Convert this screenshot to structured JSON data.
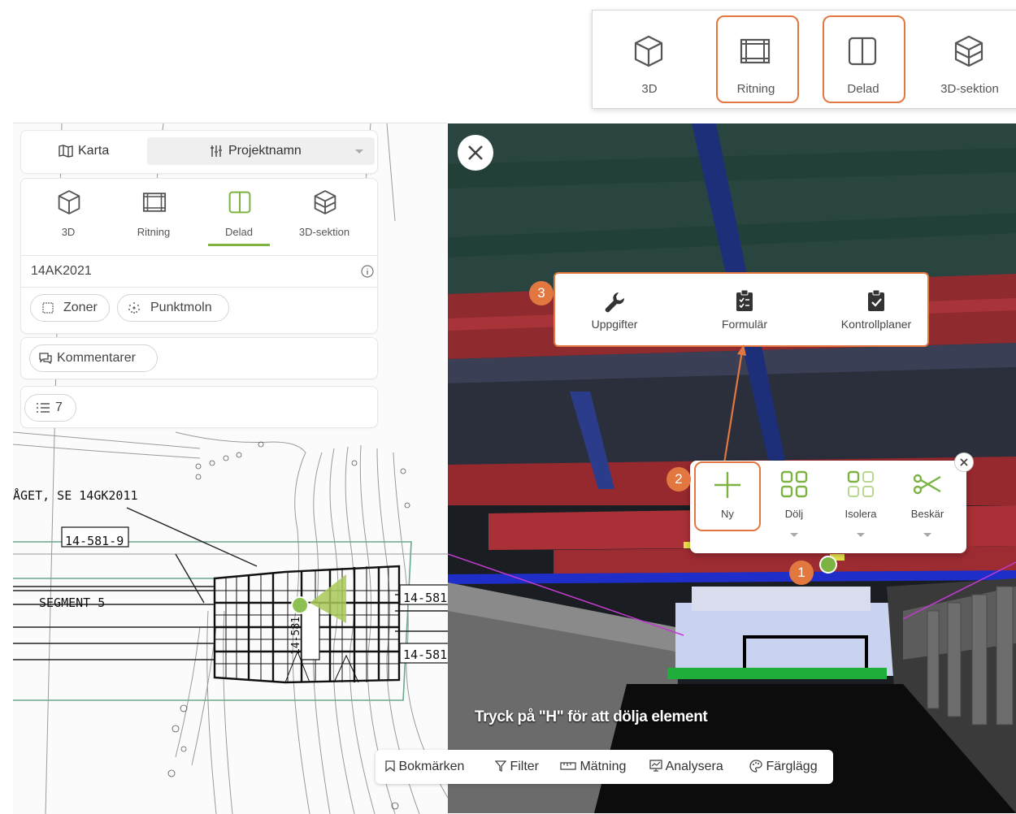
{
  "colors": {
    "accent_orange": "#e2773f",
    "active_green": "#7cb342",
    "badge_orange": "#e2773f"
  },
  "top_toolbar": {
    "items": [
      {
        "label": "3D",
        "icon": "cube-icon"
      },
      {
        "label": "Ritning",
        "icon": "drawing-icon"
      },
      {
        "label": "Delad",
        "icon": "split-view-icon"
      },
      {
        "label": "3D-sektion",
        "icon": "cube-section-icon"
      }
    ]
  },
  "left_panel": {
    "tabs": [
      {
        "label": "Karta",
        "icon": "map-icon"
      },
      {
        "label": "Projektnamn",
        "icon": "project-icon"
      }
    ],
    "modes": [
      {
        "label": "3D",
        "icon": "cube-icon"
      },
      {
        "label": "Ritning",
        "icon": "drawing-icon"
      },
      {
        "label": "Delad",
        "icon": "split-view-icon",
        "active": true
      },
      {
        "label": "3D-sektion",
        "icon": "cube-section-icon"
      }
    ],
    "drawing_id": "14AK2021",
    "chips": [
      {
        "label": "Zoner",
        "icon": "zone-icon"
      },
      {
        "label": "Punktmoln",
        "icon": "point-cloud-icon"
      }
    ],
    "comments_label": "Kommentarer",
    "list_count": "7"
  },
  "cad": {
    "label_1": "ÅGET, SE 14GK2011",
    "label_2": "14-581-9",
    "label_3": "SEGMENT 5",
    "label_4": "14-581",
    "label_5": "14-581",
    "label_6": "14-581"
  },
  "view3d": {
    "task_menu": [
      {
        "label": "Uppgifter",
        "icon": "wrench-icon"
      },
      {
        "label": "Formulär",
        "icon": "form-icon"
      },
      {
        "label": "Kontrollplaner",
        "icon": "checklist-icon"
      }
    ],
    "context_menu": [
      {
        "label": "Ny",
        "icon": "plus-icon"
      },
      {
        "label": "Dölj",
        "icon": "hide-grid-icon"
      },
      {
        "label": "Isolera",
        "icon": "isolate-grid-icon"
      },
      {
        "label": "Beskär",
        "icon": "scissors-icon"
      }
    ],
    "hint": "Tryck på \"H\" för att dölja element",
    "badges": [
      "1",
      "2",
      "3"
    ]
  },
  "bottom_toolbar": {
    "items": [
      {
        "label": "Bokmärken",
        "icon": "bookmark-icon"
      },
      {
        "label": "Filter",
        "icon": "filter-icon"
      },
      {
        "label": "Mätning",
        "icon": "ruler-icon"
      },
      {
        "label": "Analysera",
        "icon": "analyze-icon"
      },
      {
        "label": "Färglägg",
        "icon": "palette-icon"
      }
    ]
  }
}
